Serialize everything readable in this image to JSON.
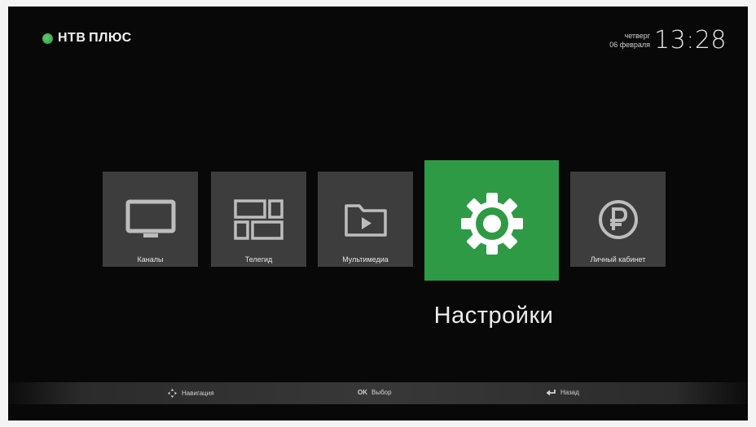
{
  "brand": {
    "name": "НТВ ПЛЮС",
    "accent_color": "#2e9a45"
  },
  "clock": {
    "weekday": "четверг",
    "date": "06 февраля",
    "time": "13:28"
  },
  "menu": {
    "tiles": [
      {
        "label": "Каналы",
        "icon": "tv-icon"
      },
      {
        "label": "Телегид",
        "icon": "guide-grid-icon"
      },
      {
        "label": "Мультимедиа",
        "icon": "folder-play-icon"
      },
      {
        "label": "Настройки",
        "icon": "gear-icon",
        "selected": true
      },
      {
        "label": "Личный кабинет",
        "icon": "ruble-icon"
      }
    ],
    "selected_title": "Настройки"
  },
  "hints": {
    "navigation": "Навигация",
    "ok_key": "OK",
    "select": "Выбор",
    "back": "Назад"
  }
}
